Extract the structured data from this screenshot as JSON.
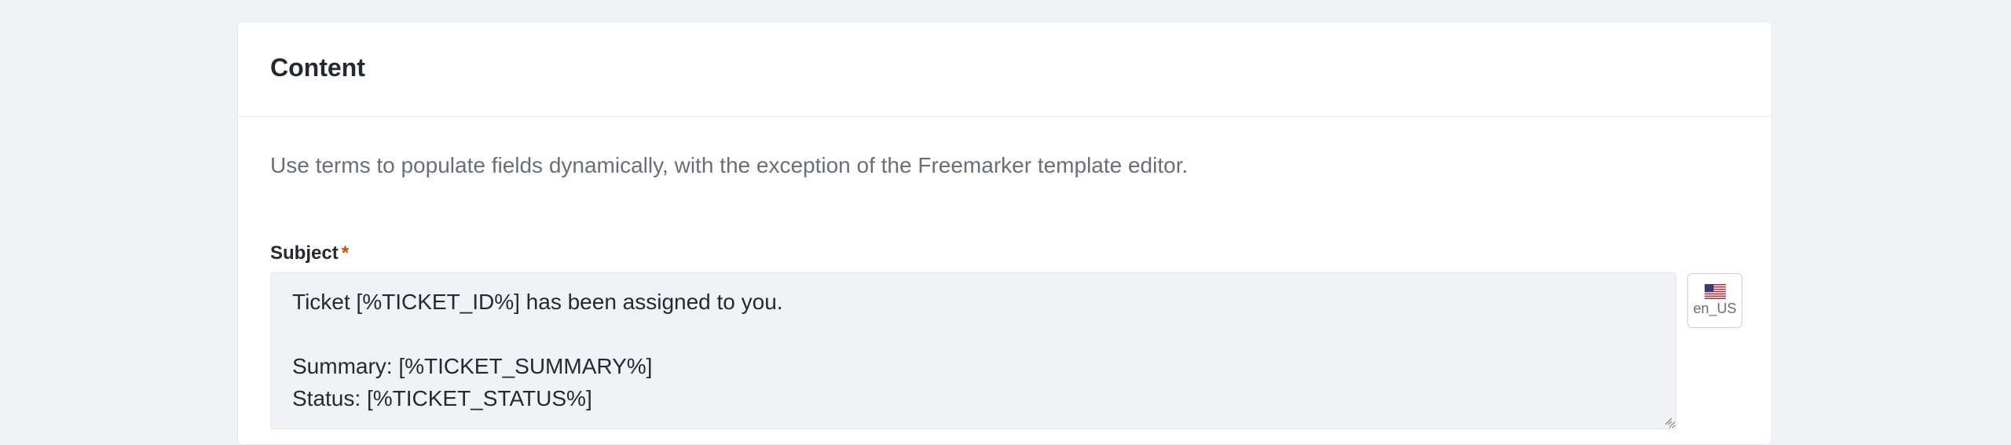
{
  "content_card": {
    "title": "Content",
    "description": "Use terms to populate fields dynamically, with the exception of the Freemarker template editor.",
    "subject": {
      "label": "Subject",
      "required_marker": "*",
      "value": "Ticket [%TICKET_ID%] has been assigned to you.\n\nSummary: [%TICKET_SUMMARY%]\nStatus: [%TICKET_STATUS%]",
      "locale": {
        "label": "en_US",
        "flag_icon": "us-flag-icon"
      }
    }
  },
  "colors": {
    "page_background": "#f1f2f5",
    "card_background": "#ffffff",
    "text_primary": "#272833",
    "text_secondary": "#6b6c7e",
    "required": "#b95000",
    "input_background": "#f1f2f5"
  }
}
